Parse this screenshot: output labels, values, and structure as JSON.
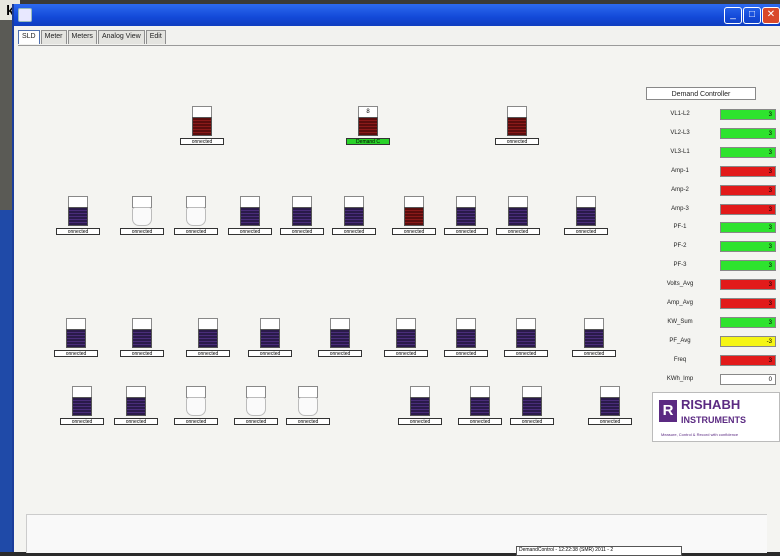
{
  "window": {
    "corner_letter": "k",
    "controls": [
      "_",
      "□",
      "✕"
    ]
  },
  "tabs": [
    "SLD",
    "Meter",
    "Meters",
    "Analog View",
    "Edit"
  ],
  "device_label": "onnected",
  "device_label_active": "Demand C",
  "top_device_number": "8",
  "demand_controller": {
    "title": "Demand Controller",
    "rows": [
      {
        "name": "VL1-L2",
        "value": "3",
        "color": "#2ee32e"
      },
      {
        "name": "VL2-L3",
        "value": "3",
        "color": "#2ee32e"
      },
      {
        "name": "VL3-L1",
        "value": "3",
        "color": "#2ee32e"
      },
      {
        "name": "Amp-1",
        "value": "3",
        "color": "#e21a1a"
      },
      {
        "name": "Amp-2",
        "value": "3",
        "color": "#e21a1a"
      },
      {
        "name": "Amp-3",
        "value": "3",
        "color": "#e21a1a"
      },
      {
        "name": "PF-1",
        "value": "3",
        "color": "#2ee32e"
      },
      {
        "name": "PF-2",
        "value": "3",
        "color": "#2ee32e"
      },
      {
        "name": "PF-3",
        "value": "3",
        "color": "#2ee32e"
      },
      {
        "name": "Volts_Avg",
        "value": "3",
        "color": "#e21a1a"
      },
      {
        "name": "Amp_Avg",
        "value": "3",
        "color": "#e21a1a"
      },
      {
        "name": "KW_Sum",
        "value": "3",
        "color": "#2ee32e"
      },
      {
        "name": "PF_Avg",
        "value": "-3",
        "color": "#f5f515"
      },
      {
        "name": "Freq",
        "value": "3",
        "color": "#e21a1a"
      },
      {
        "name": "KWh_Imp",
        "value": "0",
        "color": "#ffffff"
      },
      {
        "name": "KVA_Demd",
        "value": "3",
        "color": "#2ee32e"
      }
    ]
  },
  "logo": {
    "letter": "R",
    "line1": "RISHABH",
    "line2": "INSTRUMENTS",
    "tagline": "Measure, Control & Record with confidence"
  },
  "status": {
    "text": "DemandControl - 12:22:38 (SMR) 2011 - 2"
  }
}
